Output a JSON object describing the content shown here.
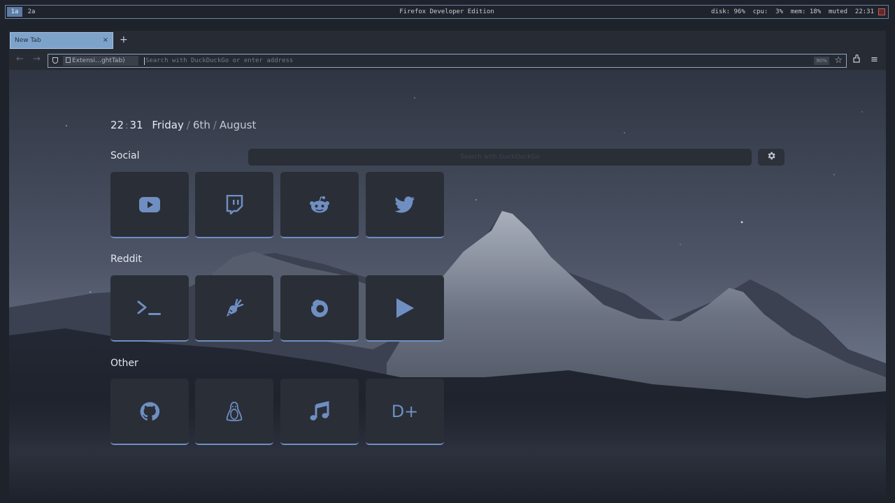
{
  "sysbar": {
    "workspaces": [
      "1a",
      "2a"
    ],
    "title": "Firefox Developer Edition",
    "status": "disk: 96%  cpu:  3%  mem: 18%  muted  22:31"
  },
  "browser": {
    "tab_title": "New Tab",
    "tab_close": "×",
    "new_tab": "+",
    "back": "←",
    "forward": "→",
    "extension_chip": "Extensi…ghtTab)",
    "url_placeholder": "Search with DuckDuckGo or enter address",
    "zoom": "90%",
    "bookmark_star": "☆",
    "menu": "≡",
    "extensions": "⬚"
  },
  "newtab": {
    "clock": {
      "hours": "22",
      "minutes": "31"
    },
    "date": {
      "weekday": "Friday",
      "day": "6th",
      "month": "August"
    },
    "search_placeholder": "Search with DuckDuckGo",
    "settings_icon": "gear-icon",
    "sections": [
      {
        "title": "Social",
        "links": [
          "youtube-icon",
          "twitch-icon",
          "reddit-icon",
          "twitter-icon"
        ]
      },
      {
        "title": "Reddit",
        "links": [
          "unixporn-icon",
          "vim-icon",
          "firefox-icon",
          "play-icon"
        ]
      },
      {
        "title": "Other",
        "links": [
          "github-icon",
          "linux-icon",
          "music-icon"
        ],
        "text_tile": "D+"
      }
    ]
  },
  "colors": {
    "accent": "#6f8fc2",
    "tile": "#2a2e37",
    "icon": "#6f8fc2",
    "background": "#272b33"
  }
}
